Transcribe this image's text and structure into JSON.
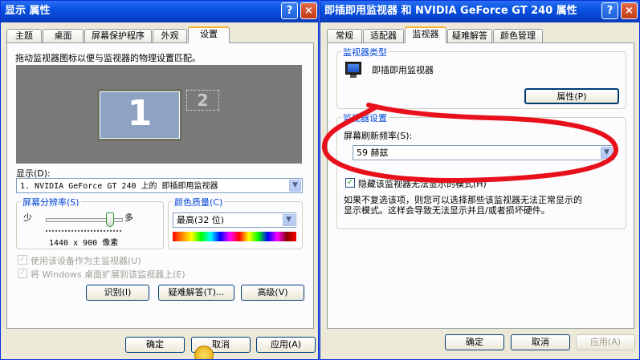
{
  "left_window": {
    "title": "显示 属性",
    "help_btn": "?",
    "close_btn": "×",
    "tabs": [
      "主题",
      "桌面",
      "屏幕保护程序",
      "外观",
      "设置"
    ],
    "instruction": "拖动监视器图标以便与监视器的物理设置匹配。",
    "monitor1": "1",
    "monitor2": "2",
    "display_label": "显示(D):",
    "display_value": "1. NVIDIA GeForce GT 240 上的 即插即用监视器",
    "resolution": {
      "group": "屏幕分辨率(S)",
      "less": "少",
      "more": "多",
      "value": "1440 x 900 像素",
      "slider_level": 0.85
    },
    "color": {
      "group": "颜色质量(C)",
      "value": "最高(32 位)"
    },
    "checkbox1": "使用该设备作为主监视器(U)",
    "checkbox2": "将 Windows 桌面扩展到该监视器上(E)",
    "buttons": {
      "identify": "识别(I)",
      "troubleshoot": "疑难解答(T)...",
      "advanced": "高级(V)"
    },
    "footer": {
      "ok": "确定",
      "cancel": "取消",
      "apply": "应用(A)"
    }
  },
  "right_window": {
    "title": "即插即用监视器 和 NVIDIA GeForce GT 240 属性",
    "help_btn": "?",
    "close_btn": "×",
    "tabs": [
      "常规",
      "适配器",
      "监视器",
      "疑难解答",
      "颜色管理"
    ],
    "monitor_type": {
      "group": "监视器类型",
      "name": "即插即用监视器",
      "properties": "属性(P)"
    },
    "monitor_settings": {
      "group": "监视器设置",
      "refresh_label": "屏幕刷新频率(S):",
      "refresh_value": "59 赫兹",
      "hide_modes": "隐藏该监视器无法显示的模式(H)",
      "note_line1": "如果不复选该项，则您可以选择那些该监视器无法正常显示的",
      "note_line2": "显示模式。这样会导致无法显示并且/或者损坏硬件。"
    },
    "footer": {
      "ok": "确定",
      "cancel": "取消",
      "apply": "应用(A)"
    }
  },
  "colors": {
    "title_blue": "#0a56e4",
    "annotation_red": "#e8101a",
    "monitor_selected": "#8ea3c2",
    "desktop_gray": "#7a7a7a"
  }
}
